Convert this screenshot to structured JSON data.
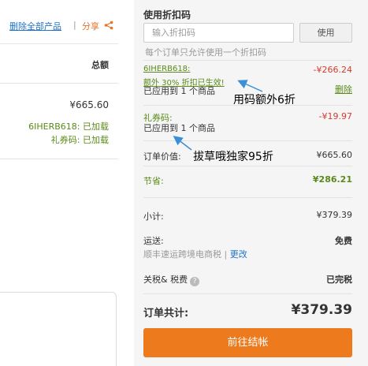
{
  "cart_header": {
    "remove_all": "删除全部产品",
    "separator": "|",
    "share": "分享",
    "total_label": "总额"
  },
  "item": {
    "price": "¥665.60",
    "code_status": "6IHERB618:  已加载",
    "gift_status": "礼券码:  已加载"
  },
  "promo": {
    "title": "使用折扣码",
    "placeholder": "输入折扣码",
    "use_button": "使用",
    "note": "每个订单只允许使用一个折扣码"
  },
  "applied_code": {
    "code": "6IHERB618:",
    "amount": "-¥266.24",
    "extra": "额外 30% 折扣已生效!",
    "applied": "已应用到 1 个商品",
    "remove": "删除"
  },
  "gift_code": {
    "label": "礼券码:",
    "amount": "-¥19.97",
    "applied": "已应用到 1 个商品"
  },
  "summary": {
    "order_value_label": "订单价值:",
    "order_value": "¥665.60",
    "savings_label": "节省:",
    "savings": "¥286.21",
    "subtotal_label": "小计:",
    "subtotal": "¥379.39",
    "shipping_label": "运送:",
    "shipping": "免费",
    "shipping_method": "顺丰速运跨境电商税",
    "shipping_sep": " | ",
    "shipping_change": "更改",
    "tax_label": "关税& 税费",
    "tax": "已完税",
    "total_label": "订单共计:",
    "total": "¥379.39",
    "checkout": "前往结帐"
  },
  "annotations": {
    "note1": "用码额外6折",
    "note2": "拔草哦独家95折"
  },
  "colors": {
    "accent": "#ee7a1e",
    "green": "#5a8a1a",
    "red": "#d33c2e",
    "link": "#1f72c8",
    "arrow": "#3a8fd6"
  }
}
